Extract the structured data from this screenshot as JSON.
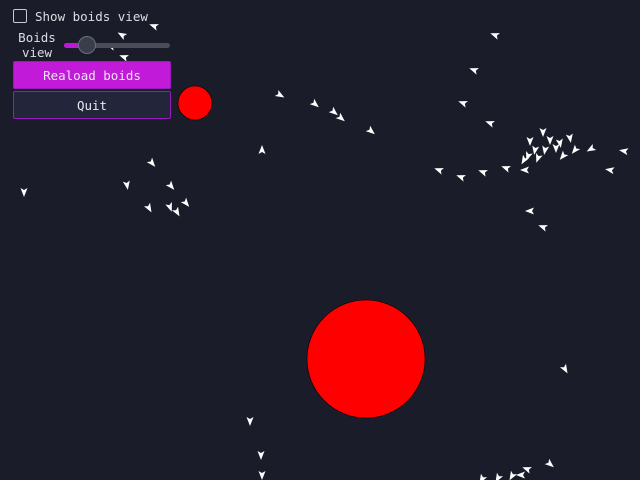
{
  "controls": {
    "show_boids_view": {
      "label": "Show boids view",
      "checked": false
    },
    "boids_view_slider": {
      "label": "Boids view",
      "value_fraction": 0.22
    },
    "reload_button": {
      "label": "Reaload boids"
    },
    "quit_button": {
      "label": "Quit"
    }
  },
  "colors": {
    "background": "#1a1d29",
    "accent": "#c21ad9",
    "obstacle": "#ff0000",
    "boid": "#ffffff"
  },
  "icons": {
    "boid": "triangle-arrow",
    "obstacle": "red-circle"
  }
}
